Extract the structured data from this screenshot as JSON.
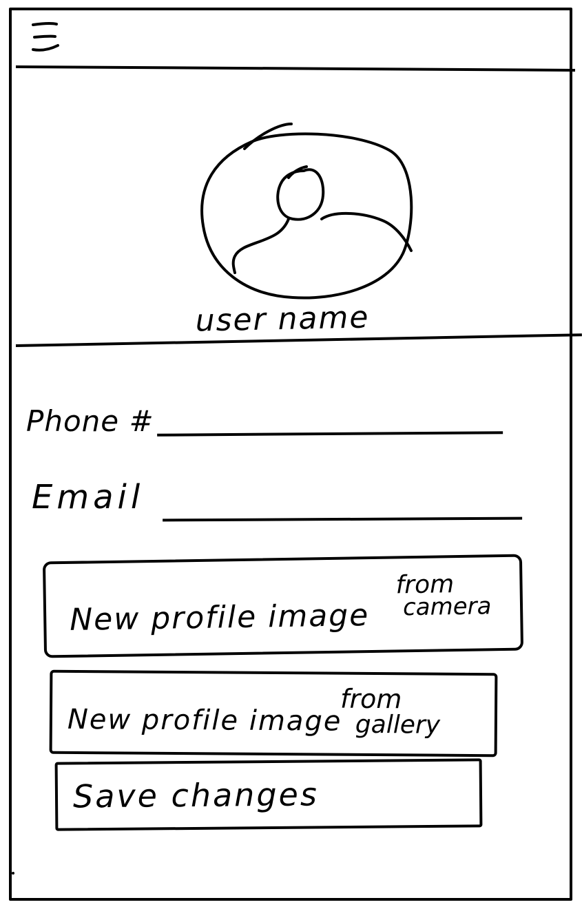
{
  "header": {
    "menu_icon": "hamburger-menu-icon"
  },
  "profile": {
    "avatar_icon": "user-avatar-icon",
    "user_name": "user name"
  },
  "form": {
    "phone": {
      "label": "Phone #",
      "value": "",
      "placeholder": ""
    },
    "email": {
      "label": "Email",
      "value": "",
      "placeholder": ""
    }
  },
  "actions": {
    "camera": {
      "label": "New profile image",
      "label_line2_a": "from",
      "label_line2_b": "camera"
    },
    "gallery": {
      "label": "New profile image",
      "label_line2_a": "from",
      "label_line2_b": "gallery"
    },
    "save": {
      "label": "Save changes"
    }
  },
  "colors": {
    "ink": "#000000",
    "paper": "#ffffff"
  }
}
